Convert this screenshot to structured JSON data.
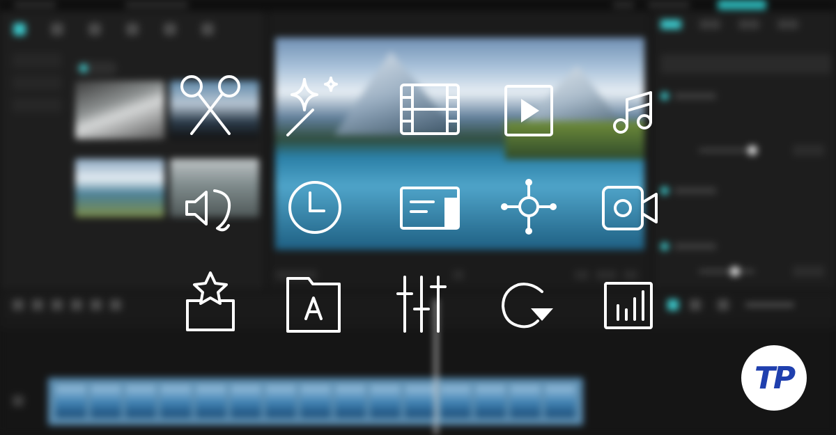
{
  "editor": {
    "media_tabs": [
      "",
      "",
      "",
      "",
      "",
      ""
    ],
    "player_title": ""
  },
  "icons": [
    {
      "name": "scissors-icon",
      "row": 1,
      "col": 1
    },
    {
      "name": "magic-wand-icon",
      "row": 1,
      "col": 2
    },
    {
      "name": "film-strip-icon",
      "row": 1,
      "col": 3
    },
    {
      "name": "play-icon",
      "row": 1,
      "col": 4
    },
    {
      "name": "music-note-icon",
      "row": 1,
      "col": 5
    },
    {
      "name": "audio-speaker-icon",
      "row": 2,
      "col": 1
    },
    {
      "name": "clock-icon",
      "row": 2,
      "col": 2
    },
    {
      "name": "caption-text-icon",
      "row": 2,
      "col": 3
    },
    {
      "name": "keyframe-node-icon",
      "row": 2,
      "col": 4
    },
    {
      "name": "video-camera-icon",
      "row": 2,
      "col": 5
    },
    {
      "name": "star-export-icon",
      "row": 3,
      "col": 1
    },
    {
      "name": "text-folder-icon",
      "row": 3,
      "col": 2
    },
    {
      "name": "equalizer-sliders-icon",
      "row": 3,
      "col": 3
    },
    {
      "name": "rotate-icon",
      "row": 3,
      "col": 4
    },
    {
      "name": "bar-chart-icon",
      "row": 3,
      "col": 5
    }
  ],
  "logo": {
    "text": "TP",
    "bg_color": "#ffffff",
    "text_color": "#1f3fae"
  },
  "colors": {
    "accent": "#3bc5c8",
    "icon_stroke": "#ffffff",
    "background": "#151515"
  }
}
